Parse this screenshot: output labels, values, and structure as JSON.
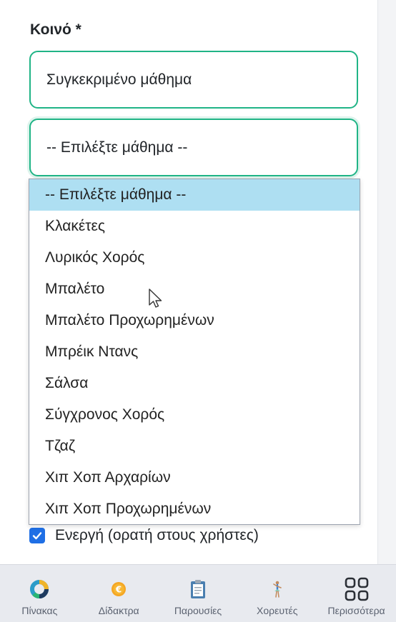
{
  "form": {
    "audience_label": "Κοινό *",
    "audience_value": "Συγκεκριμένο μάθημα",
    "lesson_value": "-- Επιλέξτε μάθημα --",
    "active_label": "Ενεργή (ορατή στους χρήστες)",
    "active_checked": true
  },
  "dropdown": {
    "options": [
      "-- Επιλέξτε μάθημα --",
      "Κλακέτες",
      "Λυρικός Χορός",
      "Μπαλέτο",
      "Μπαλέτο Προχωρημένων",
      "Μπρέικ Ντανς",
      "Σάλσα",
      "Σύγχρονος Χορός",
      "Τζαζ",
      "Χιπ Χοπ Αρχαρίων",
      "Χιπ Χοπ Προχωρημένων"
    ],
    "selected_index": 0
  },
  "bottom_nav": {
    "items": [
      {
        "label": "Πίνακας",
        "icon": "dashboard-donut-icon"
      },
      {
        "label": "Δίδακτρα",
        "icon": "euro-coin-icon"
      },
      {
        "label": "Παρουσίες",
        "icon": "clipboard-icon"
      },
      {
        "label": "Χορευτές",
        "icon": "dancer-icon"
      },
      {
        "label": "Περισσότερα",
        "icon": "grid-icon"
      }
    ]
  },
  "colors": {
    "accent_green": "#20b486",
    "selected_option": "#aedff2",
    "checkbox_blue": "#1f6fe5",
    "nav_background": "#e8eaef"
  }
}
